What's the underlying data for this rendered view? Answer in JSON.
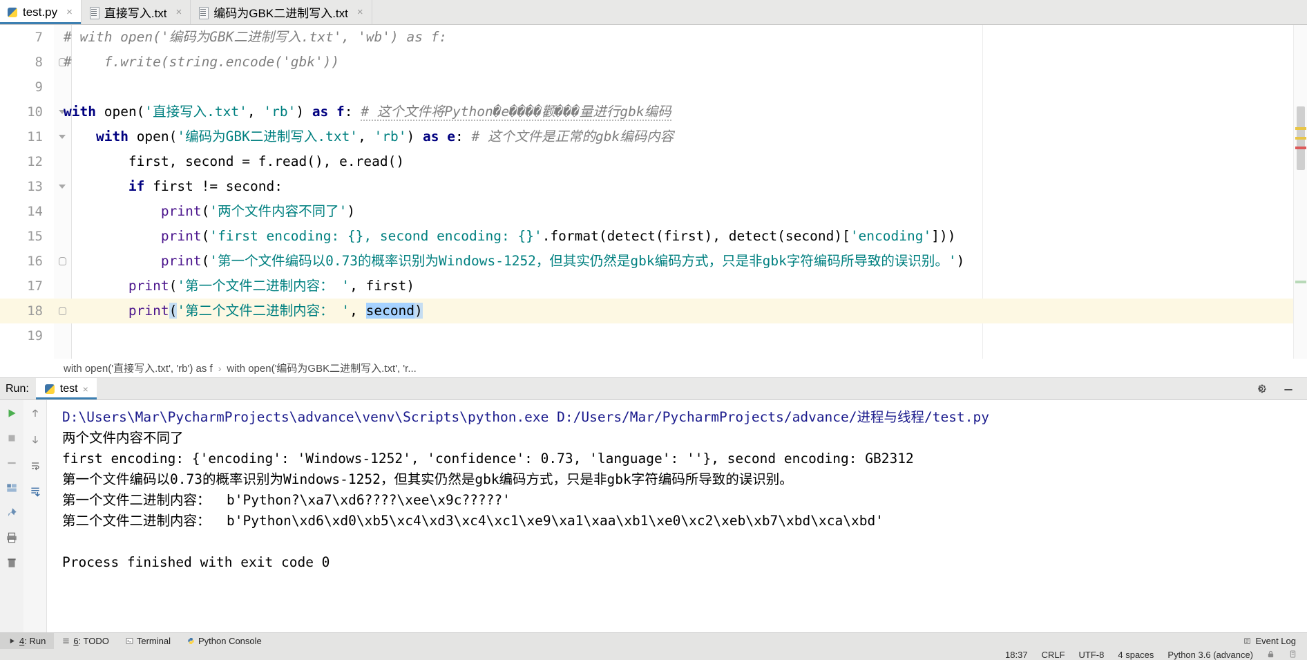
{
  "window": {
    "app": "PyCharm"
  },
  "tabs": [
    {
      "label": "test.py",
      "icon": "python-file-icon",
      "active": true,
      "close": "×"
    },
    {
      "label": "直接写入.txt",
      "icon": "text-file-icon",
      "active": false,
      "close": "×"
    },
    {
      "label": "编码为GBK二进制写入.txt",
      "icon": "text-file-icon",
      "active": false,
      "close": "×"
    }
  ],
  "editor": {
    "lines": [
      {
        "num": "7",
        "current": false,
        "fold": "",
        "text": "# with open('编码为GBK二进制写入.txt', 'wb') as f:"
      },
      {
        "num": "8",
        "current": false,
        "fold": "oval",
        "text": "#     f.write(string.encode('gbk'))"
      },
      {
        "num": "9",
        "current": false,
        "fold": "",
        "text": ""
      },
      {
        "num": "10",
        "current": false,
        "fold": "tri",
        "text": "with open('直接写入.txt', 'rb') as f: # 这个文件将Python�e����颧���量进行gbk编码"
      },
      {
        "num": "11",
        "current": false,
        "fold": "tri",
        "text": "    with open('编码为GBK二进制写入.txt', 'rb') as e: # 这个文件是正常的gbk编码内容"
      },
      {
        "num": "12",
        "current": false,
        "fold": "",
        "text": "        first, second = f.read(), e.read()"
      },
      {
        "num": "13",
        "current": false,
        "fold": "tri",
        "text": "        if first != second:"
      },
      {
        "num": "14",
        "current": false,
        "fold": "",
        "text": "            print('两个文件内容不同了')"
      },
      {
        "num": "15",
        "current": false,
        "fold": "",
        "text": "            print('first encoding: {}, second encoding: {}'.format(detect(first), detect(second)['encoding']))"
      },
      {
        "num": "16",
        "current": false,
        "fold": "oval",
        "text": "            print('第一个文件编码以0.73的概率识别为Windows-1252，但其实仍然是gbk编码方式，只是非gbk字符编码所导致的误识别。')"
      },
      {
        "num": "17",
        "current": false,
        "fold": "",
        "text": "        print('第一个文件二进制内容： ', first)"
      },
      {
        "num": "18",
        "current": true,
        "fold": "oval",
        "text": "        print('第二个文件二进制内容： ', second)"
      },
      {
        "num": "19",
        "current": false,
        "fold": "",
        "text": ""
      }
    ],
    "comment_line10": "# 这个文件将Python�e����颧���量进行gbk编码",
    "comment_line11": "# 这个文件是正常的gbk编码内容"
  },
  "breadcrumb": {
    "items": [
      "with open('直接写入.txt', 'rb') as f",
      "with open('编码为GBK二进制写入.txt', 'r..."
    ],
    "separator": "›"
  },
  "run_panel": {
    "label": "Run:",
    "tab": {
      "label": "test",
      "icon": "python-file-icon",
      "close": "×"
    },
    "settings_icon": "gear-icon",
    "minimize_icon": "minimize-icon",
    "toolbar_left": [
      {
        "name": "rerun-button",
        "glyph": "▶"
      },
      {
        "name": "stop-button",
        "glyph": "■"
      },
      {
        "name": "resume-button",
        "glyph": "▬"
      },
      {
        "name": "layout-button",
        "glyph": "▦"
      },
      {
        "name": "pin-button",
        "glyph": "📌"
      },
      {
        "name": "print-button",
        "glyph": "🖶"
      },
      {
        "name": "delete-button",
        "glyph": "🗑"
      }
    ],
    "toolbar_left2": [
      {
        "name": "up-arrow-button",
        "glyph": "↑"
      },
      {
        "name": "down-arrow-button",
        "glyph": "↓"
      },
      {
        "name": "soft-wrap-button",
        "glyph": "⇥"
      },
      {
        "name": "scroll-to-end-button",
        "glyph": "⤓"
      }
    ],
    "output": [
      {
        "cmd": true,
        "text": "D:\\Users\\Mar\\PycharmProjects\\advance\\venv\\Scripts\\python.exe D:/Users/Mar/PycharmProjects/advance/进程与线程/test.py"
      },
      {
        "cmd": false,
        "text": "两个文件内容不同了"
      },
      {
        "cmd": false,
        "text": "first encoding: {'encoding': 'Windows-1252', 'confidence': 0.73, 'language': ''}, second encoding: GB2312"
      },
      {
        "cmd": false,
        "text": "第一个文件编码以0.73的概率识别为Windows-1252，但其实仍然是gbk编码方式，只是非gbk字符编码所导致的误识别。"
      },
      {
        "cmd": false,
        "text": "第一个文件二进制内容：  b'Python?\\xa7\\xd6????\\xee\\x9c?????'"
      },
      {
        "cmd": false,
        "text": "第二个文件二进制内容：  b'Python\\xd6\\xd0\\xb5\\xc4\\xd3\\xc4\\xc1\\xe9\\xa1\\xaa\\xb1\\xe0\\xc2\\xeb\\xb7\\xbd\\xca\\xbd'"
      },
      {
        "cmd": false,
        "text": ""
      },
      {
        "cmd": false,
        "text": "Process finished with exit code 0"
      }
    ]
  },
  "bottom_toolbar": {
    "items": [
      {
        "name": "tool-window-run",
        "num": "4",
        "label": ": Run",
        "icon": "play-icon",
        "active": true
      },
      {
        "name": "tool-window-todo",
        "num": "6",
        "label": ": TODO",
        "icon": "list-icon",
        "active": false
      },
      {
        "name": "tool-window-terminal",
        "num": "",
        "label": "Terminal",
        "icon": "terminal-icon",
        "active": false
      },
      {
        "name": "tool-window-python-console",
        "num": "",
        "label": "Python Console",
        "icon": "python-icon",
        "active": false
      }
    ],
    "event_log": {
      "label": "Event Log",
      "icon": "event-log-icon"
    }
  },
  "status_bar": {
    "time": "18:37",
    "line_separator": "CRLF",
    "encoding": "UTF-8",
    "indent": "4 spaces",
    "interpreter": "Python 3.6 (advance)",
    "lock_icon": "lock-icon",
    "hide_icon": "hide-icon"
  },
  "colors": {
    "keyword": "#000080",
    "string": "#008080",
    "function": "#4a148c",
    "comment": "#808080",
    "number": "#0000ff",
    "current_line": "#fdf8e3",
    "tab_underline": "#3c7fb1",
    "console_cmd": "#1a1a8c"
  }
}
